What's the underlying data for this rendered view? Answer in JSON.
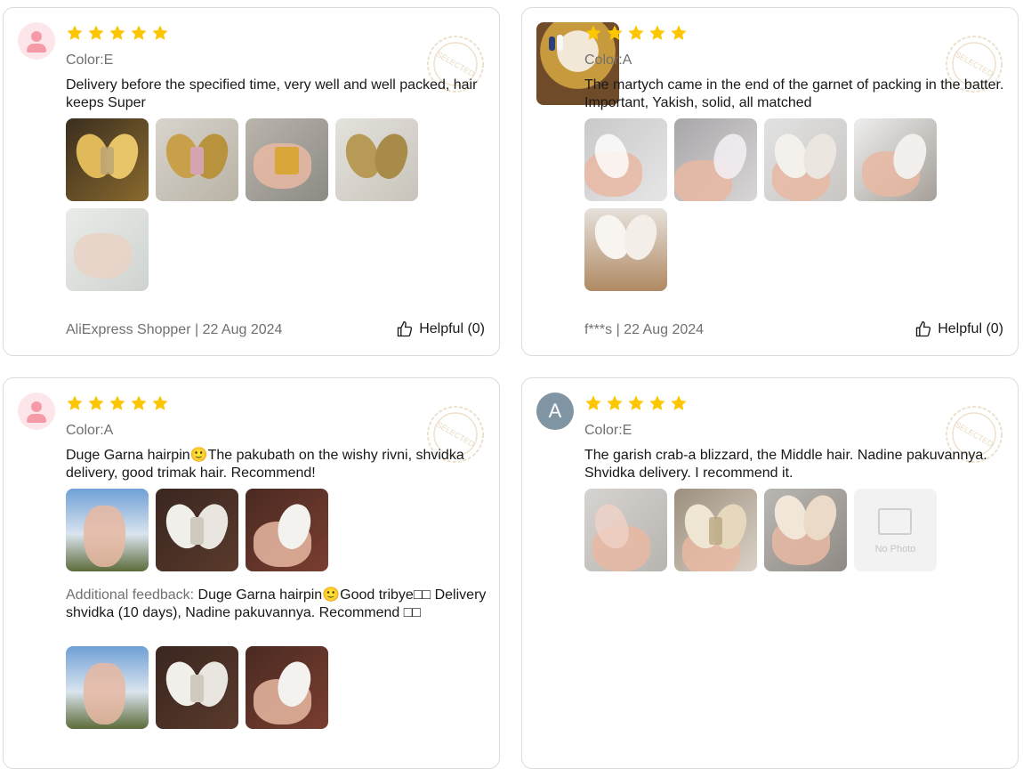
{
  "reviews": [
    {
      "avatar": "default-avatar-icon",
      "rating": 5,
      "color": "Color:E",
      "text": "Delivery before the specified time, very well and well packed, hair keeps Super",
      "photo_count": 5,
      "author": "AliExpress Shopper",
      "date": "22 Aug 2024",
      "meta": "AliExpress Shopper | 22 Aug 2024",
      "helpful": "Helpful (0)",
      "stamp": "SELECTED"
    },
    {
      "avatar": "user-photo-avatar",
      "rating": 5,
      "color": "Color:A",
      "text": "The martych came in the end of the garnet of packing in the batter. Important, Yakish, solid, all matched",
      "photo_count": 5,
      "author": "f***s",
      "date": "22 Aug 2024",
      "meta": "f***s | 22 Aug 2024",
      "helpful": "Helpful (0)",
      "stamp": "SELECTED"
    },
    {
      "avatar": "default-avatar-icon",
      "rating": 5,
      "color": "Color:A",
      "text": "Duge Garna hairpin🙂The pakubath on the wishy rivni, shvidka delivery, good trimak hair. Recommend!",
      "photo_count": 3,
      "additional_label": "Additional feedback:",
      "additional_text": " Duge Garna hairpin🙂Good tribye□□ Delivery shvidka (10 days), Nadine pakuvannya. Recommend □□",
      "additional_photo_count": 3,
      "stamp": "SELECTED"
    },
    {
      "avatar_letter": "A",
      "rating": 5,
      "color": "Color:E",
      "text": "The garish crab-a blizzard, the Middle hair. Nadine pakuvannya. Shvidka delivery. I recommend it.",
      "photo_count": 3,
      "no_photo_label": "No Photo",
      "stamp": "SELECTED"
    }
  ],
  "colors": {
    "star": "#fcc600",
    "meta_text": "#707070",
    "body_text": "#191919",
    "border": "#dcdcdc",
    "stamp": "#e0c9a6"
  }
}
